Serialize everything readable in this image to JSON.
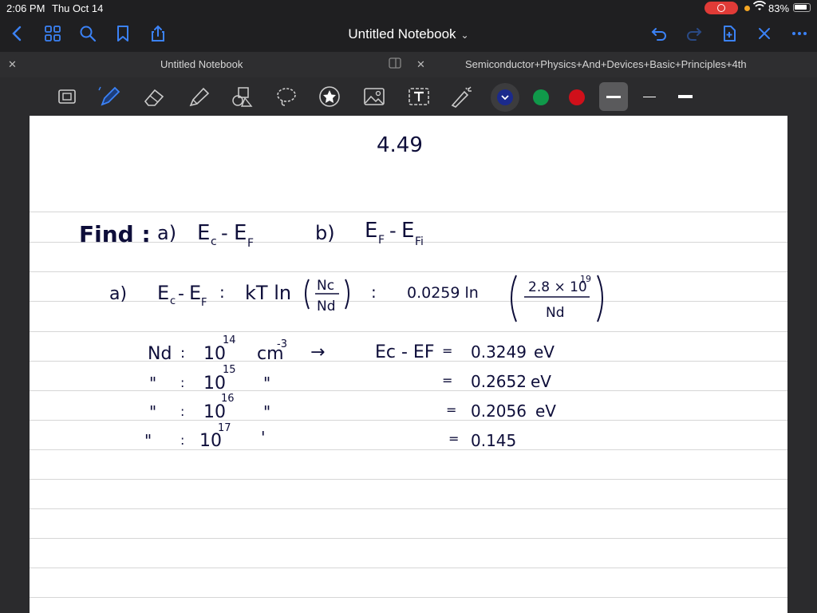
{
  "status": {
    "time": "2:06 PM",
    "date": "Thu Oct 14",
    "battery": "83%"
  },
  "nav": {
    "title": "Untitled Notebook"
  },
  "tabs": [
    {
      "label": "Untitled Notebook"
    },
    {
      "label": "Semiconductor+Physics+And+Devices+Basic+Principles+4th"
    }
  ],
  "colors": {
    "swatch1": "#1b2a8c",
    "swatch2": "#10994a",
    "swatch3": "#d0101a",
    "accent": "#3b82f6"
  },
  "note": {
    "problem_number": "4.49",
    "find": "Find :",
    "part_a": "a)",
    "part_b": "b)",
    "ec": "E",
    "ec_sub": "c",
    "ef": "E",
    "ef_sub": "F",
    "efi_sub": "Fi",
    "dash": "-",
    "eq": ":",
    "kt_ln": "kT ln",
    "nc": "Nc",
    "nd": "Nd",
    "const_ln": "0.0259 ln",
    "num": "2.8 × 10",
    "num_exp": "19",
    "table": [
      {
        "lhs": "Nd",
        "sep": ":",
        "val": "10",
        "exp": "14",
        "unit": "cm",
        "unit_exp": "-3",
        "arrow": "→",
        "res_label": "Ec - EF",
        "res_eq": "=",
        "result": "0.3249",
        "res_unit": "eV"
      },
      {
        "lhs": "\"",
        "sep": ":",
        "val": "10",
        "exp": "15",
        "unit": "\"",
        "unit_exp": "",
        "arrow": "",
        "res_label": "",
        "res_eq": "=",
        "result": "0.2652",
        "res_unit": "eV"
      },
      {
        "lhs": "\"",
        "sep": ":",
        "val": "10",
        "exp": "16",
        "unit": "\"",
        "unit_exp": "",
        "arrow": "",
        "res_label": "",
        "res_eq": "=",
        "result": "0.2056",
        "res_unit": "eV"
      },
      {
        "lhs": "\"",
        "sep": ":",
        "val": "10",
        "exp": "17",
        "unit": "'",
        "unit_exp": "",
        "arrow": "",
        "res_label": "",
        "res_eq": "=",
        "result": "0.145",
        "res_unit": ""
      }
    ]
  }
}
